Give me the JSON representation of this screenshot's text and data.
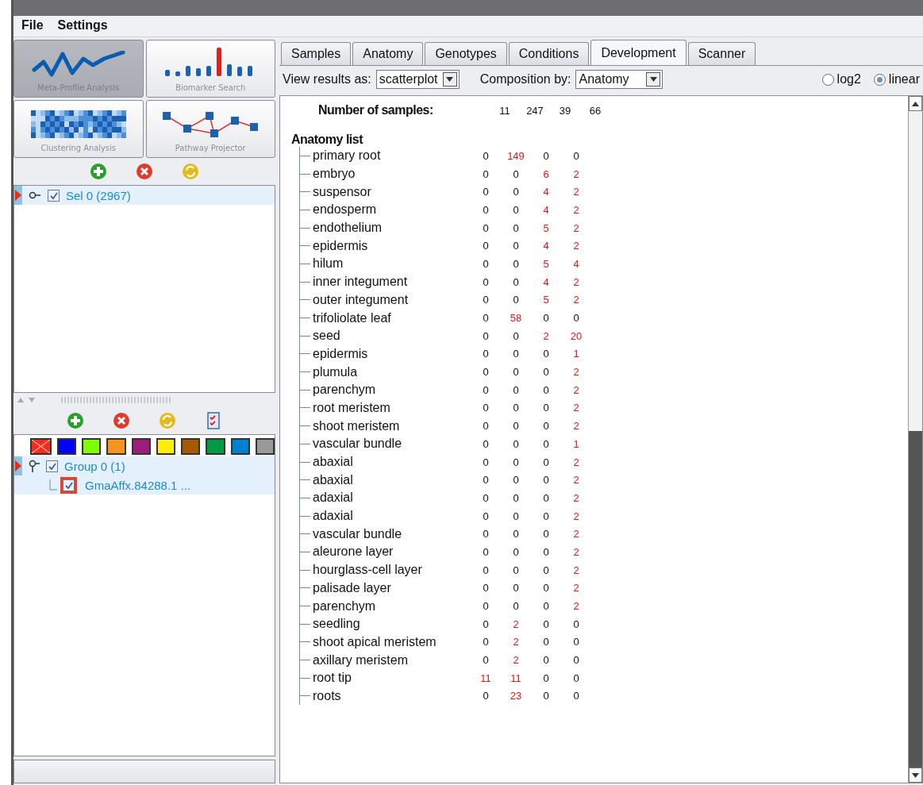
{
  "menu": [
    "File",
    "Settings"
  ],
  "tools": [
    {
      "label": "Meta-Profile Analysis",
      "kind": "line",
      "selected": true
    },
    {
      "label": "Biomarker Search",
      "kind": "bars",
      "selected": false
    },
    {
      "label": "Clustering Analysis",
      "kind": "heatmap",
      "selected": false
    },
    {
      "label": "Pathway Projector",
      "kind": "pathway",
      "selected": false
    }
  ],
  "selections": {
    "toolbar": [
      {
        "kind": "add"
      },
      {
        "kind": "remove"
      },
      {
        "kind": "refresh"
      }
    ],
    "items": [
      {
        "label": "Sel 0 (2967)",
        "checked": true,
        "selected": true
      }
    ]
  },
  "groups": {
    "toolbar": [
      {
        "kind": "add"
      },
      {
        "kind": "remove"
      },
      {
        "kind": "refresh"
      },
      {
        "kind": "checklist"
      }
    ],
    "swatches": [
      {
        "color": "#ff2a1a",
        "crossed": true
      },
      {
        "color": "#0000ff",
        "crossed": false
      },
      {
        "color": "#80ff00",
        "crossed": false
      },
      {
        "color": "#f7941d",
        "crossed": false
      },
      {
        "color": "#9b1f7a",
        "crossed": false
      },
      {
        "color": "#ffee00",
        "crossed": false
      },
      {
        "color": "#a65a00",
        "crossed": false
      },
      {
        "color": "#009a44",
        "crossed": false
      },
      {
        "color": "#0080d0",
        "crossed": false
      },
      {
        "color": "#999999",
        "crossed": false
      }
    ],
    "items": [
      {
        "label": "Group 0 (1)",
        "checked": true,
        "selected": true,
        "children": [
          {
            "label": "GmaAffx.84288.1 ...",
            "checked": true,
            "flagged": true
          }
        ]
      }
    ]
  },
  "tabs": [
    {
      "label": "Samples",
      "selected": false
    },
    {
      "label": "Anatomy",
      "selected": false
    },
    {
      "label": "Genotypes",
      "selected": false
    },
    {
      "label": "Conditions",
      "selected": false
    },
    {
      "label": "Development",
      "selected": true
    },
    {
      "label": "Scanner",
      "selected": false
    }
  ],
  "options": {
    "view_label": "View results as:",
    "view_value": "scatterplot",
    "composition_label": "Composition by:",
    "composition_value": "Anatomy",
    "scale": [
      {
        "label": "log2",
        "selected": false
      },
      {
        "label": "linear",
        "selected": true
      }
    ]
  },
  "results": {
    "samples_label": "Number of samples:",
    "samples": [
      "11",
      "247",
      "39",
      "66"
    ],
    "list_title": "Anatomy list",
    "rows": [
      {
        "name": "primary root",
        "values": [
          "0",
          "149",
          "0",
          "0"
        ],
        "highlighted": [
          false,
          true,
          false,
          false
        ]
      },
      {
        "name": "embryo",
        "values": [
          "0",
          "0",
          "6",
          "2"
        ],
        "highlighted": [
          false,
          false,
          true,
          true
        ]
      },
      {
        "name": "suspensor",
        "values": [
          "0",
          "0",
          "4",
          "2"
        ],
        "highlighted": [
          false,
          false,
          true,
          true
        ]
      },
      {
        "name": "endosperm",
        "values": [
          "0",
          "0",
          "4",
          "2"
        ],
        "highlighted": [
          false,
          false,
          true,
          true
        ]
      },
      {
        "name": "endothelium",
        "values": [
          "0",
          "0",
          "5",
          "2"
        ],
        "highlighted": [
          false,
          false,
          true,
          true
        ]
      },
      {
        "name": "epidermis",
        "values": [
          "0",
          "0",
          "4",
          "2"
        ],
        "highlighted": [
          false,
          false,
          true,
          true
        ]
      },
      {
        "name": "hilum",
        "values": [
          "0",
          "0",
          "5",
          "4"
        ],
        "highlighted": [
          false,
          false,
          true,
          true
        ]
      },
      {
        "name": "inner integument",
        "values": [
          "0",
          "0",
          "4",
          "2"
        ],
        "highlighted": [
          false,
          false,
          true,
          true
        ]
      },
      {
        "name": "outer integument",
        "values": [
          "0",
          "0",
          "5",
          "2"
        ],
        "highlighted": [
          false,
          false,
          true,
          true
        ]
      },
      {
        "name": "trifoliolate leaf",
        "values": [
          "0",
          "58",
          "0",
          "0"
        ],
        "highlighted": [
          false,
          true,
          false,
          false
        ]
      },
      {
        "name": "seed",
        "values": [
          "0",
          "0",
          "2",
          "20"
        ],
        "highlighted": [
          false,
          false,
          true,
          true
        ]
      },
      {
        "name": "epidermis",
        "values": [
          "0",
          "0",
          "0",
          "1"
        ],
        "highlighted": [
          false,
          false,
          false,
          true
        ]
      },
      {
        "name": "plumula",
        "values": [
          "0",
          "0",
          "0",
          "2"
        ],
        "highlighted": [
          false,
          false,
          false,
          true
        ]
      },
      {
        "name": "parenchym",
        "values": [
          "0",
          "0",
          "0",
          "2"
        ],
        "highlighted": [
          false,
          false,
          false,
          true
        ]
      },
      {
        "name": "root meristem",
        "values": [
          "0",
          "0",
          "0",
          "2"
        ],
        "highlighted": [
          false,
          false,
          false,
          true
        ]
      },
      {
        "name": "shoot meristem",
        "values": [
          "0",
          "0",
          "0",
          "2"
        ],
        "highlighted": [
          false,
          false,
          false,
          true
        ]
      },
      {
        "name": "vascular bundle",
        "values": [
          "0",
          "0",
          "0",
          "1"
        ],
        "highlighted": [
          false,
          false,
          false,
          true
        ]
      },
      {
        "name": "abaxial",
        "values": [
          "0",
          "0",
          "0",
          "2"
        ],
        "highlighted": [
          false,
          false,
          false,
          true
        ]
      },
      {
        "name": "abaxial",
        "values": [
          "0",
          "0",
          "0",
          "2"
        ],
        "highlighted": [
          false,
          false,
          false,
          true
        ]
      },
      {
        "name": "adaxial",
        "values": [
          "0",
          "0",
          "0",
          "2"
        ],
        "highlighted": [
          false,
          false,
          false,
          true
        ]
      },
      {
        "name": "adaxial",
        "values": [
          "0",
          "0",
          "0",
          "2"
        ],
        "highlighted": [
          false,
          false,
          false,
          true
        ]
      },
      {
        "name": "vascular bundle",
        "values": [
          "0",
          "0",
          "0",
          "2"
        ],
        "highlighted": [
          false,
          false,
          false,
          true
        ]
      },
      {
        "name": "aleurone layer",
        "values": [
          "0",
          "0",
          "0",
          "2"
        ],
        "highlighted": [
          false,
          false,
          false,
          true
        ]
      },
      {
        "name": "hourglass-cell layer",
        "values": [
          "0",
          "0",
          "0",
          "2"
        ],
        "highlighted": [
          false,
          false,
          false,
          true
        ]
      },
      {
        "name": "palisade layer",
        "values": [
          "0",
          "0",
          "0",
          "2"
        ],
        "highlighted": [
          false,
          false,
          false,
          true
        ]
      },
      {
        "name": "parenchym",
        "values": [
          "0",
          "0",
          "0",
          "2"
        ],
        "highlighted": [
          false,
          false,
          false,
          true
        ]
      },
      {
        "name": "seedling",
        "values": [
          "0",
          "2",
          "0",
          "0"
        ],
        "highlighted": [
          false,
          true,
          false,
          false
        ]
      },
      {
        "name": "shoot apical meristem",
        "values": [
          "0",
          "2",
          "0",
          "0"
        ],
        "highlighted": [
          false,
          true,
          false,
          false
        ]
      },
      {
        "name": "axillary meristem",
        "values": [
          "0",
          "2",
          "0",
          "0"
        ],
        "highlighted": [
          false,
          true,
          false,
          false
        ]
      },
      {
        "name": "root tip",
        "values": [
          "11",
          "11",
          "0",
          "0"
        ],
        "highlighted": [
          true,
          true,
          false,
          false
        ]
      },
      {
        "name": "roots",
        "values": [
          "0",
          "23",
          "0",
          "0"
        ],
        "highlighted": [
          false,
          true,
          false,
          false
        ]
      }
    ]
  }
}
